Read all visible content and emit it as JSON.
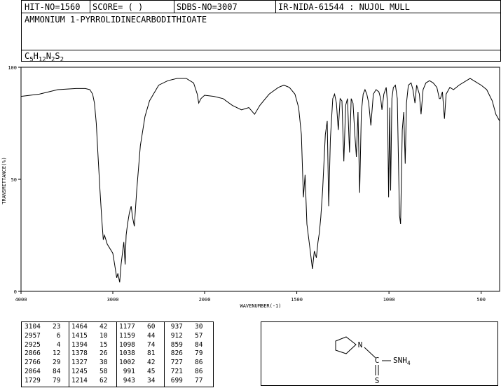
{
  "header": {
    "hit_no": "HIT-NO=1560",
    "score": "SCORE=  (   )",
    "sdbs_no": "SDBS-NO=3007",
    "ir_id": "IR-NIDA-61544 : NUJOL MULL",
    "compound_name": "AMMONIUM 1-PYRROLIDINECARBODITHIOATE",
    "formula": {
      "parts": [
        "C",
        "5",
        "H",
        "12",
        "N",
        "2",
        "S",
        "2"
      ]
    }
  },
  "chart_data": {
    "type": "line",
    "xlabel": "WAVENUMBER(-1)",
    "ylabel": "TRANSMITTANCE(%)",
    "xlim": [
      4000,
      400
    ],
    "ylim": [
      0,
      100
    ],
    "x_ticks": [
      4000,
      3000,
      2000,
      1500,
      1000,
      500
    ],
    "y_ticks": [
      0,
      50,
      100
    ],
    "grid": false,
    "series": [
      {
        "points": [
          [
            4000,
            87
          ],
          [
            3800,
            88
          ],
          [
            3600,
            90
          ],
          [
            3400,
            90.5
          ],
          [
            3300,
            90.5
          ],
          [
            3250,
            90
          ],
          [
            3220,
            88
          ],
          [
            3200,
            84
          ],
          [
            3180,
            75
          ],
          [
            3160,
            60
          ],
          [
            3140,
            45
          ],
          [
            3120,
            32
          ],
          [
            3104,
            23
          ],
          [
            3090,
            25
          ],
          [
            3060,
            21
          ],
          [
            3030,
            19
          ],
          [
            3000,
            17
          ],
          [
            2980,
            12
          ],
          [
            2957,
            6
          ],
          [
            2945,
            8
          ],
          [
            2925,
            4
          ],
          [
            2910,
            12
          ],
          [
            2880,
            22
          ],
          [
            2866,
            12
          ],
          [
            2855,
            25
          ],
          [
            2840,
            30
          ],
          [
            2820,
            35
          ],
          [
            2800,
            38
          ],
          [
            2785,
            33
          ],
          [
            2766,
            29
          ],
          [
            2740,
            45
          ],
          [
            2700,
            65
          ],
          [
            2650,
            78
          ],
          [
            2600,
            85
          ],
          [
            2500,
            92
          ],
          [
            2400,
            94
          ],
          [
            2300,
            95
          ],
          [
            2200,
            95
          ],
          [
            2120,
            93
          ],
          [
            2080,
            88
          ],
          [
            2064,
            84
          ],
          [
            2040,
            86
          ],
          [
            2000,
            87.5
          ],
          [
            1950,
            87
          ],
          [
            1900,
            86
          ],
          [
            1850,
            83
          ],
          [
            1800,
            81
          ],
          [
            1760,
            82
          ],
          [
            1729,
            79
          ],
          [
            1700,
            83
          ],
          [
            1650,
            88
          ],
          [
            1600,
            91
          ],
          [
            1570,
            92
          ],
          [
            1540,
            91
          ],
          [
            1510,
            88
          ],
          [
            1490,
            82
          ],
          [
            1475,
            70
          ],
          [
            1464,
            42
          ],
          [
            1455,
            52
          ],
          [
            1445,
            30
          ],
          [
            1430,
            20
          ],
          [
            1415,
            10
          ],
          [
            1405,
            18
          ],
          [
            1394,
            15
          ],
          [
            1385,
            22
          ],
          [
            1378,
            26
          ],
          [
            1370,
            33
          ],
          [
            1360,
            45
          ],
          [
            1345,
            70
          ],
          [
            1335,
            76
          ],
          [
            1327,
            38
          ],
          [
            1318,
            68
          ],
          [
            1305,
            86
          ],
          [
            1295,
            88
          ],
          [
            1285,
            84
          ],
          [
            1275,
            72
          ],
          [
            1265,
            86
          ],
          [
            1255,
            85
          ],
          [
            1245,
            58
          ],
          [
            1235,
            83
          ],
          [
            1225,
            86
          ],
          [
            1214,
            62
          ],
          [
            1205,
            86
          ],
          [
            1195,
            84
          ],
          [
            1185,
            70
          ],
          [
            1177,
            60
          ],
          [
            1168,
            80
          ],
          [
            1159,
            44
          ],
          [
            1150,
            80
          ],
          [
            1140,
            88
          ],
          [
            1130,
            90
          ],
          [
            1120,
            88
          ],
          [
            1110,
            84
          ],
          [
            1098,
            74
          ],
          [
            1085,
            88
          ],
          [
            1070,
            90
          ],
          [
            1055,
            89
          ],
          [
            1045,
            86
          ],
          [
            1038,
            81
          ],
          [
            1028,
            88
          ],
          [
            1015,
            91
          ],
          [
            1008,
            84
          ],
          [
            1002,
            42
          ],
          [
            996,
            82
          ],
          [
            991,
            45
          ],
          [
            984,
            86
          ],
          [
            976,
            91
          ],
          [
            965,
            92
          ],
          [
            955,
            86
          ],
          [
            943,
            34
          ],
          [
            937,
            30
          ],
          [
            928,
            72
          ],
          [
            920,
            80
          ],
          [
            912,
            57
          ],
          [
            905,
            84
          ],
          [
            895,
            92
          ],
          [
            880,
            93
          ],
          [
            870,
            90
          ],
          [
            859,
            84
          ],
          [
            850,
            92
          ],
          [
            835,
            88
          ],
          [
            826,
            79
          ],
          [
            815,
            90
          ],
          [
            800,
            93
          ],
          [
            780,
            94
          ],
          [
            760,
            93
          ],
          [
            740,
            91
          ],
          [
            727,
            86
          ],
          [
            721,
            86
          ],
          [
            710,
            89
          ],
          [
            699,
            77
          ],
          [
            690,
            88
          ],
          [
            670,
            91
          ],
          [
            650,
            90
          ],
          [
            620,
            92
          ],
          [
            580,
            94
          ],
          [
            560,
            95
          ],
          [
            540,
            94
          ],
          [
            520,
            93
          ],
          [
            500,
            92
          ],
          [
            470,
            90
          ],
          [
            440,
            85
          ],
          [
            420,
            79
          ],
          [
            400,
            76
          ]
        ]
      }
    ]
  },
  "peak_table": {
    "columns": [
      [
        [
          3104,
          23
        ],
        [
          2957,
          6
        ],
        [
          2925,
          4
        ],
        [
          2866,
          12
        ],
        [
          2766,
          29
        ],
        [
          2064,
          84
        ],
        [
          1729,
          79
        ]
      ],
      [
        [
          1464,
          42
        ],
        [
          1415,
          10
        ],
        [
          1394,
          15
        ],
        [
          1378,
          26
        ],
        [
          1327,
          38
        ],
        [
          1245,
          58
        ],
        [
          1214,
          62
        ]
      ],
      [
        [
          1177,
          60
        ],
        [
          1159,
          44
        ],
        [
          1098,
          74
        ],
        [
          1038,
          81
        ],
        [
          1002,
          42
        ],
        [
          991,
          45
        ],
        [
          943,
          34
        ]
      ],
      [
        [
          937,
          30
        ],
        [
          912,
          57
        ],
        [
          859,
          84
        ],
        [
          826,
          79
        ],
        [
          727,
          86
        ],
        [
          721,
          86
        ],
        [
          699,
          77
        ]
      ]
    ]
  },
  "structure": {
    "atoms": [
      "N",
      "C",
      "SNH",
      "4",
      "S"
    ]
  }
}
